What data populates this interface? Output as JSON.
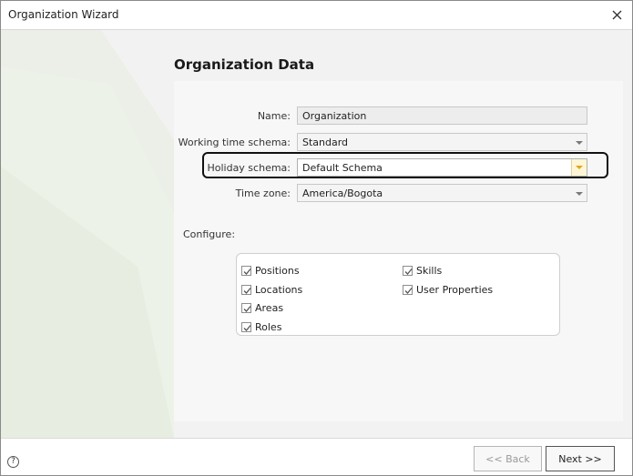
{
  "window": {
    "title": "Organization Wizard",
    "close_icon": "close-icon"
  },
  "page": {
    "heading": "Organization Data"
  },
  "form": {
    "name": {
      "label": "Name:",
      "value": "Organization"
    },
    "working_time_schema": {
      "label": "Working time schema:",
      "value": "Standard"
    },
    "holiday_schema": {
      "label": "Holiday schema:",
      "value": "Default Schema"
    },
    "time_zone": {
      "label": "Time zone:",
      "value": "America/Bogota"
    }
  },
  "configure": {
    "label": "Configure:",
    "items": [
      {
        "label": "Positions",
        "checked": true
      },
      {
        "label": "Locations",
        "checked": true
      },
      {
        "label": "Areas",
        "checked": true
      },
      {
        "label": "Roles",
        "checked": true
      },
      {
        "label": "Skills",
        "checked": true
      },
      {
        "label": "User Properties",
        "checked": true
      }
    ]
  },
  "footer": {
    "help_icon": "?",
    "back_label": "<< Back",
    "next_label": "Next >>"
  },
  "colors": {
    "highlight": "#111111",
    "panel_bg": "#f2f2f2",
    "accent_dropdown": "#e0a51e"
  }
}
